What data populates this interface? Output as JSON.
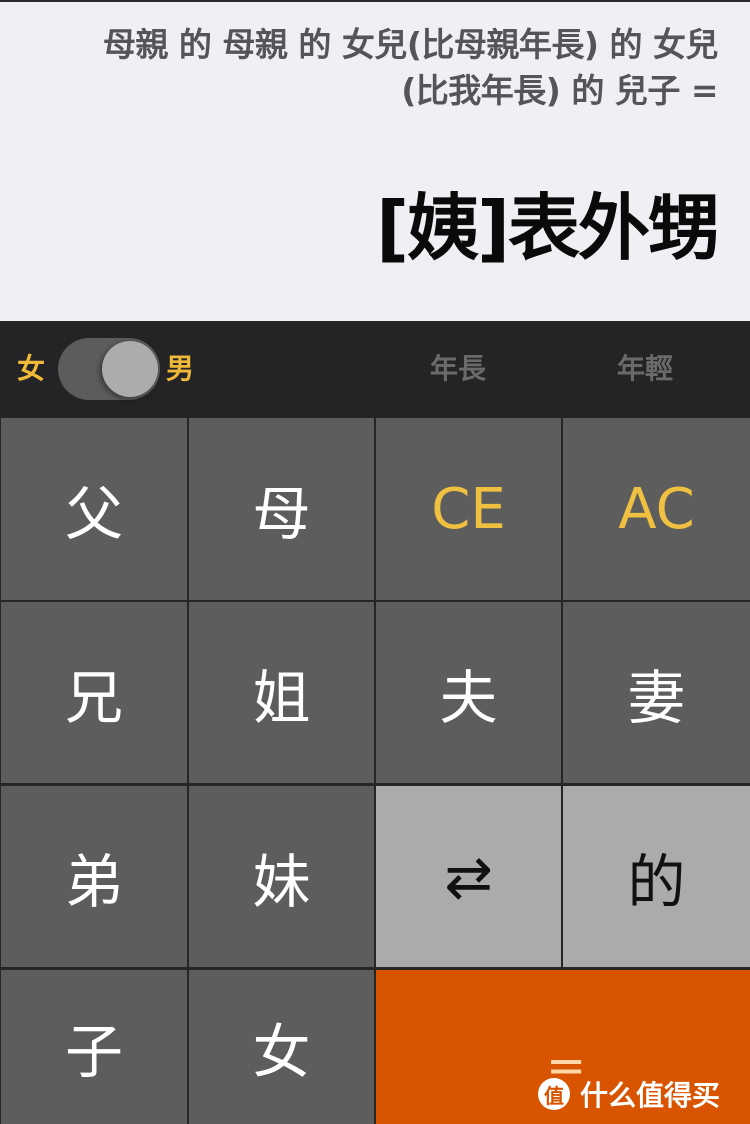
{
  "display": {
    "expression": "母親 的 母親 的 女兒(比母親年長) 的 女兒(比我年長) 的 兒子 =",
    "result": "[姨]表外甥"
  },
  "toolbar": {
    "gender_female": "女",
    "gender_male": "男",
    "gender_selected": "男",
    "older": "年長",
    "younger": "年輕"
  },
  "keys": {
    "father": "父",
    "mother": "母",
    "clear_entry": "CE",
    "all_clear": "AC",
    "elder_brother": "兄",
    "elder_sister": "姐",
    "husband": "夫",
    "wife": "妻",
    "younger_brother": "弟",
    "younger_sister": "妹",
    "swap": "⇄",
    "of": "的",
    "son": "子",
    "daughter": "女",
    "equals": "="
  },
  "colors": {
    "accent": "#f0b93a",
    "equals_bg": "#d95400",
    "key_bg": "#5d5d5d",
    "light_key_bg": "#ababab",
    "display_bg": "#efeff4"
  },
  "watermark": {
    "icon": "值",
    "text": "什么值得买"
  }
}
